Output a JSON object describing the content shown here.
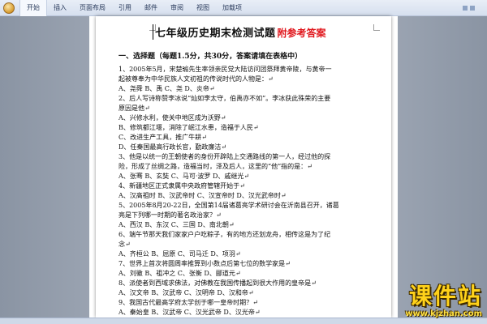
{
  "ribbon": {
    "tabs": [
      "开始",
      "插入",
      "页面布局",
      "引用",
      "邮件",
      "审阅",
      "视图",
      "加载项"
    ],
    "active_tab_index": 0
  },
  "document": {
    "title": "七年级历史期末检测试题",
    "title_note": "附参考答案",
    "section_heading": "一、选择题（每题1.5分，共30分，答案请填在表格中）",
    "lines": [
      "1、2005年5月，宋楚瑜先生率领亲民党大陆访问团祭拜黄帝陵，与黄帝一",
      "起被尊奉为中华民族人文初祖的传说时代的人物是：↵",
      "A、尧舜         B、禹         C、尧         D、炎帝↵",
      "2、后人写诗称赞李冰说“灿如李太守，伯禹亦不如”。李冰获此殊荣的主要",
      "原因是他↵",
      "A、兴修水利，使关中地区成为沃野↵",
      "B、修筑都江堰，消除了岷江水患，造福于人民↵",
      "C、改进生产工具，推广牛耕↵",
      "D、任秦国最高行政长官，勤政廉洁↵",
      "3、他是以统一的王朝使者的身份开辟陆上交通路线的第一人，经过他的探",
      "险，形成了丝绸之路，造福当时，泽及后人，这里的“他”指的是：↵",
      "A、张骞        B、玄奘        C、马可·波罗        D、戚继光↵",
      "4、新疆地区正式隶属中央政府管辖开始于↵",
      "A、汉高祖时        B、汉武帝时        C、汉宣帝时        D、汉光武帝时↵",
      "5、2005年8月20-22日，全国第14届诸葛亮学术研讨会在沂南县召开，诸葛",
      "亮是下列哪一时期的著名政治家？↵",
      "A、西汉        B、东汉        C、三国        D、南北朝↵",
      "6、端午节那天我们家家户户吃粽子，有的地方还划龙舟，相传这是为了纪",
      "念↵",
      "A、齐桓公        B、屈原        C、司马迁        D、项羽↵",
      "7、世界上首次将圆周率推算到小数点后第七位的数学家是↵",
      "A、刘徽        B、祖冲之        C、张衡        D、郦道元↵",
      "8、派使者到西域求佛法，对佛教在我国传播起到很大作用的皇帝是↵",
      "A、汉文帝        B、汉武帝        C、汉明帝        D、汉和帝↵",
      "9、我国古代最高学府太学创于哪一皇帝时期？↵",
      "A、秦始皇        B、汉武帝        C、汉光武帝        D、汉光帝↵"
    ]
  },
  "watermark": {
    "name": "课件站",
    "url": "www.kjzhan.com"
  }
}
